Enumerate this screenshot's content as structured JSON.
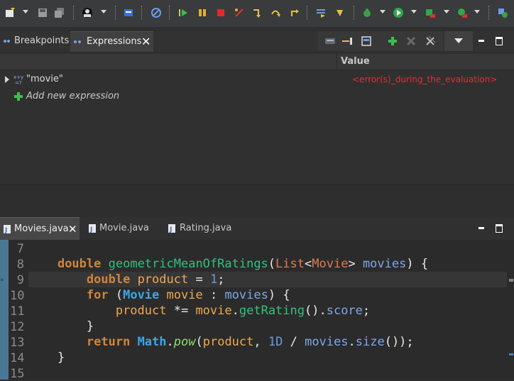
{
  "view_tabs": {
    "breakpoints": "Breakpoints",
    "expressions": "Expressions"
  },
  "columns": {
    "name": "",
    "value": "Value"
  },
  "expressions": [
    {
      "name": "\"movie\"",
      "value": "<error(s)_during_the_evaluation>"
    }
  ],
  "add_expression": "Add new expression",
  "editor_tabs": [
    "Movies.java",
    "Movie.java",
    "Rating.java"
  ],
  "line_numbers": [
    "7",
    "8",
    "9",
    "10",
    "11",
    "12",
    "13",
    "14",
    "15"
  ],
  "code": {
    "l8": {
      "kw": "double",
      "fn": "geometricMeanOfRatings",
      "p1": "(",
      "ty1": "List",
      "lt": "<",
      "ty2": "Movie",
      "gt": ">",
      "pa": "movies",
      "p2": ") {"
    },
    "l9": {
      "kw": "double",
      "lo": "product",
      "p1": " = ",
      "nu": "1",
      "p2": ";"
    },
    "l10": {
      "kw": "for",
      "p1": " (",
      "ty": "Movie",
      "lo": "movie",
      "p2": " : ",
      "pa": "movies",
      "p3": ") {"
    },
    "l11": {
      "lo1": "product",
      "p1": " *= ",
      "lo2": "movie",
      "p2": ".",
      "fn": "getRating",
      "p3": "().",
      "va": "score",
      "p4": ";"
    },
    "l12": {
      "p1": "}"
    },
    "l13": {
      "kw": "return",
      "cl": "Math",
      "p1": ".",
      "it": "pow",
      "p2": "(",
      "lo": "product",
      "p3": ", ",
      "nu": "1D",
      "p4": " / ",
      "pa": "movies",
      "p5": ".",
      "fn": "size",
      "p6": "());"
    },
    "l14": {
      "p1": "}"
    }
  },
  "colors": {
    "error": "#e03030",
    "ruler": "#4a7894",
    "keyword": "#d2843a"
  }
}
